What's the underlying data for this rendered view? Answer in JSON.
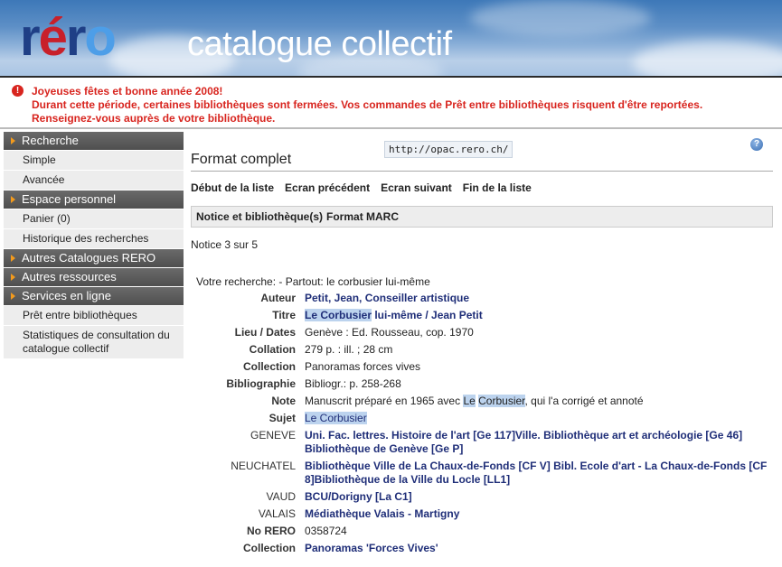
{
  "banner": {
    "logo": {
      "r1": "r",
      "e": "é",
      "r2": "r",
      "o": "o"
    },
    "title": "catalogue collectif"
  },
  "alert": {
    "icon": "!",
    "line1": "Joyeuses fêtes et bonne année 2008!",
    "line2": "Durant cette période, certaines bibliothèques sont fermées. Vos commandes de Prêt entre bibliothèques risquent d'être reportées.",
    "line3": "Renseignez-vous auprès de votre bibliothèque.",
    "color": "#d8251f"
  },
  "sidebar": {
    "recherche": "Recherche",
    "simple": "Simple",
    "avancee": "Avancée",
    "espace": "Espace personnel",
    "panier": "Panier (0)",
    "historique": "Historique des recherches",
    "autres_catalogues": "Autres Catalogues RERO",
    "autres_ressources": "Autres ressources",
    "services": "Services en ligne",
    "pret": "Prêt entre bibliothèques",
    "stats_l1": "Statistiques de consultation du",
    "stats_l2": "catalogue collectif"
  },
  "main": {
    "url": "http://opac.rero.ch/",
    "help": "?",
    "title": "Format complet",
    "nav": {
      "debut": "Début de la liste",
      "precedent": "Ecran précédent",
      "suivant": "Ecran suivant",
      "fin": "Fin de la liste"
    },
    "tabs": {
      "notice": "Notice et bibliothèque(s)",
      "marc": "Format MARC"
    },
    "notice_count": "Notice 3 sur 5",
    "search_line": "Votre recherche: - Partout: le corbusier lui-même"
  },
  "record": {
    "auteur_lbl": "Auteur",
    "auteur_val": "Petit, Jean, Conseiller artistique",
    "titre_lbl": "Titre",
    "titre_hl": "Le Corbusier",
    "titre_rest": " lui-même / Jean Petit",
    "lieu_lbl": "Lieu / Dates",
    "lieu_val": "Genève : Ed. Rousseau, cop. 1970",
    "collation_lbl": "Collation",
    "collation_val": "279 p. : ill. ; 28 cm",
    "collection_lbl": "Collection",
    "collection_val": "Panoramas forces vives",
    "biblio_lbl": "Bibliographie",
    "biblio_val": "Bibliogr.: p. 258-268",
    "note_lbl": "Note",
    "note_pre": "Manuscrit préparé en 1965 avec ",
    "note_hl1": "Le",
    "note_sp": " ",
    "note_hl2": "Corbusier",
    "note_post": ", qui l'a corrigé et annoté",
    "sujet_lbl": "Sujet",
    "sujet_val": "Le Corbusier",
    "geneve_lbl": "GENEVE",
    "geneve_l1": "Uni. Fac. lettres. Histoire de l'art [Ge 117]Ville. Bibliothèque art et archéologie [Ge 46]",
    "geneve_l2": "Bibliothèque de Genève [Ge P]",
    "neuchatel_lbl": "NEUCHATEL",
    "neuchatel_l1": "Bibliothèque Ville de La Chaux-de-Fonds [CF V] Bibl. Ecole d'art - La Chaux-de-Fonds [CF",
    "neuchatel_l2": "8]Bibliothèque de la Ville du Locle [LL1]",
    "vaud_lbl": "VAUD",
    "vaud_val": "BCU/Dorigny [La C1]",
    "valais_lbl": "VALAIS",
    "valais_val": "Médiathèque Valais - Martigny",
    "norero_lbl": "No RERO",
    "norero_val": "0358724",
    "collection2_lbl": "Collection",
    "collection2_val": "Panoramas 'Forces Vives'"
  }
}
